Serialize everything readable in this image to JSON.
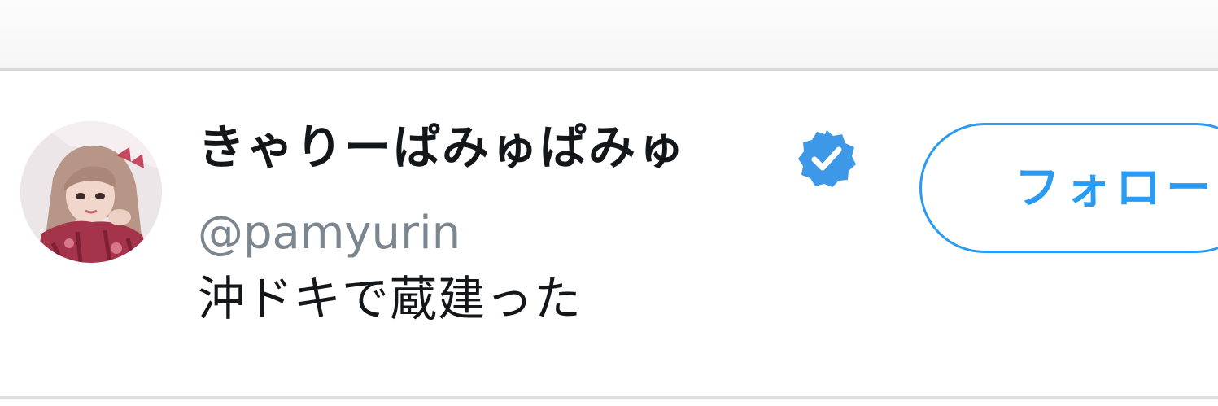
{
  "user": {
    "display_name": "きゃりーぱみゅぱみゅ",
    "handle": "@pamyurin",
    "verified": true,
    "avatar_icon": "profile-photo"
  },
  "tweet": {
    "text": "沖ドキで蔵建った"
  },
  "follow_button": {
    "label": "フォロー"
  },
  "colors": {
    "accent": "#2a9bf0",
    "name_text": "#14171a",
    "handle_text": "#7c868f",
    "divider": "#d6d9dc"
  }
}
